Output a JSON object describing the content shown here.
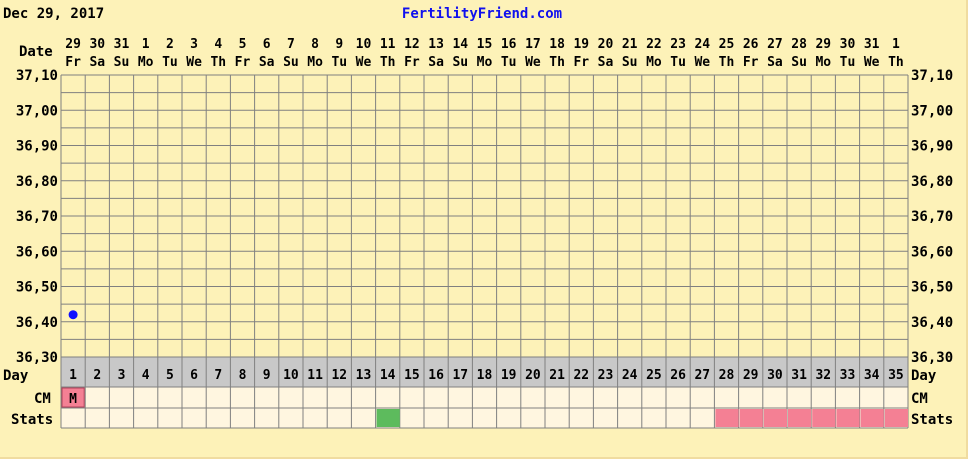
{
  "header": {
    "date_text": "Dec 29, 2017",
    "site_text": "FertilityFriend.com"
  },
  "labels": {
    "date": "Date",
    "day": "Day",
    "cm": "CM",
    "stats": "Stats"
  },
  "colors": {
    "background": "#fdf2b8",
    "grid": "#808080",
    "point": "#1010ff",
    "stats_green": "#5dbb5d",
    "stats_pink": "#f48094",
    "cm_pink": "#f48094",
    "day_row": "#c8c8c8"
  },
  "chart_data": {
    "type": "scatter",
    "ylim": [
      36.3,
      37.1
    ],
    "y_step": 0.05,
    "y_ticks": [
      "37,10",
      "37,00",
      "36,90",
      "36,80",
      "36,70",
      "36,60",
      "36,50",
      "36,40",
      "36,30"
    ],
    "y_tick_values": [
      37.1,
      37.0,
      36.9,
      36.8,
      36.7,
      36.6,
      36.5,
      36.4,
      36.3
    ],
    "dates": [
      "29",
      "30",
      "31",
      "1",
      "2",
      "3",
      "4",
      "5",
      "6",
      "7",
      "8",
      "9",
      "10",
      "11",
      "12",
      "13",
      "14",
      "15",
      "16",
      "17",
      "18",
      "19",
      "20",
      "21",
      "22",
      "23",
      "24",
      "25",
      "26",
      "27",
      "28",
      "29",
      "30",
      "31",
      "1"
    ],
    "weekdays": [
      "Fr",
      "Sa",
      "Su",
      "Mo",
      "Tu",
      "We",
      "Th",
      "Fr",
      "Sa",
      "Su",
      "Mo",
      "Tu",
      "We",
      "Th",
      "Fr",
      "Sa",
      "Su",
      "Mo",
      "Tu",
      "We",
      "Th",
      "Fr",
      "Sa",
      "Su",
      "Mo",
      "Tu",
      "We",
      "Th",
      "Fr",
      "Sa",
      "Su",
      "Mo",
      "Tu",
      "We",
      "Th"
    ],
    "cycle_days": [
      "1",
      "2",
      "3",
      "4",
      "5",
      "6",
      "7",
      "8",
      "9",
      "10",
      "11",
      "12",
      "13",
      "14",
      "15",
      "16",
      "17",
      "18",
      "19",
      "20",
      "21",
      "22",
      "23",
      "24",
      "25",
      "26",
      "27",
      "28",
      "29",
      "30",
      "31",
      "32",
      "33",
      "34",
      "35"
    ],
    "temperatures": [
      {
        "day": 1,
        "value": 36.42
      }
    ],
    "cm": [
      {
        "day": 1,
        "value": "M"
      }
    ],
    "stats": [
      {
        "day": 14,
        "color": "green"
      },
      {
        "day": 28,
        "color": "pink"
      },
      {
        "day": 29,
        "color": "pink"
      },
      {
        "day": 30,
        "color": "pink"
      },
      {
        "day": 31,
        "color": "pink"
      },
      {
        "day": 32,
        "color": "pink"
      },
      {
        "day": 33,
        "color": "pink"
      },
      {
        "day": 34,
        "color": "pink"
      },
      {
        "day": 35,
        "color": "pink"
      }
    ]
  }
}
